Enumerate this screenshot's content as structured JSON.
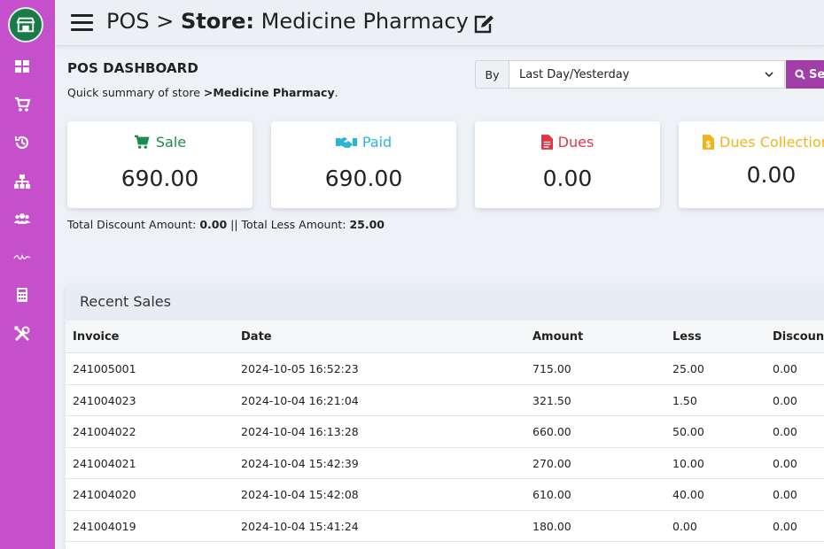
{
  "header": {
    "breadcrumb_pos": "POS",
    "separator": ">",
    "store_label": "Store:",
    "store_name": "Medicine Pharmacy"
  },
  "dashboard": {
    "title": "POS DASHBOARD",
    "subtitle_prefix": "Quick summary of store ",
    "subtitle_store": ">Medicine Pharmacy",
    "subtitle_suffix": "."
  },
  "filter": {
    "by_label": "By",
    "selected": "Last Day/Yesterday",
    "search_label": "Se"
  },
  "cards": [
    {
      "label": "Sale",
      "value": "690.00",
      "color": "#1e8a4f",
      "icon": "cart-icon"
    },
    {
      "label": "Paid",
      "value": "690.00",
      "color": "#2bb6d8",
      "icon": "handshake-icon"
    },
    {
      "label": "Dues",
      "value": "0.00",
      "color": "#e0364a",
      "icon": "file-icon"
    },
    {
      "label": "Dues Collection",
      "value": "0.00",
      "color": "#f1b51c",
      "icon": "file-dollar-icon"
    }
  ],
  "summary": {
    "discount_label": "Total Discount Amount: ",
    "discount_value": "0.00",
    "separator": " || ",
    "less_label": "Total Less Amount: ",
    "less_value": "25.00"
  },
  "recent_sales": {
    "title": "Recent Sales",
    "columns": [
      "Invoice",
      "Date",
      "Amount",
      "Less",
      "Discoun"
    ],
    "rows": [
      [
        "241005001",
        "2024-10-05 16:52:23",
        "715.00",
        "25.00",
        "0.00"
      ],
      [
        "241004023",
        "2024-10-04 16:21:04",
        "321.50",
        "1.50",
        "0.00"
      ],
      [
        "241004022",
        "2024-10-04 16:13:28",
        "660.00",
        "50.00",
        "0.00"
      ],
      [
        "241004021",
        "2024-10-04 15:42:39",
        "270.00",
        "10.00",
        "0.00"
      ],
      [
        "241004020",
        "2024-10-04 15:42:08",
        "610.00",
        "40.00",
        "0.00"
      ],
      [
        "241004019",
        "2024-10-04 15:41:24",
        "180.00",
        "0.00",
        "0.00"
      ],
      [
        "",
        "",
        "",
        "",
        ""
      ]
    ]
  },
  "sidebar": {
    "icons": [
      "store-icon",
      "dashboard-icon",
      "cart-icon",
      "history-icon",
      "sitemap-icon",
      "users-icon",
      "signature-icon",
      "calculator-icon",
      "tools-icon"
    ]
  },
  "colors": {
    "sidebar": "#c64fcb",
    "accent": "#a23ea7"
  }
}
